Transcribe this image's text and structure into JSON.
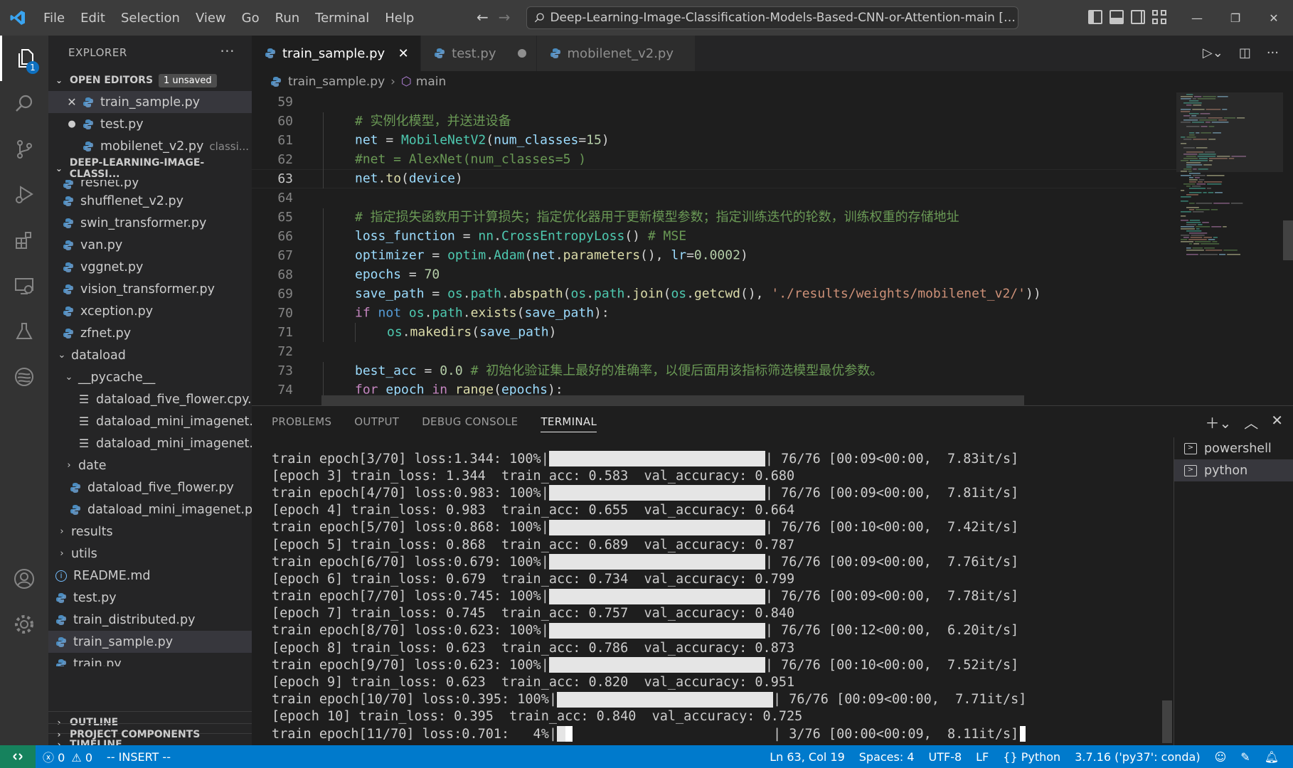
{
  "menu": [
    "File",
    "Edit",
    "Selection",
    "View",
    "Go",
    "Run",
    "Terminal",
    "Help"
  ],
  "search": {
    "text": "Deep-Learning-Image-Classification-Models-Based-CNN-or-Attention-main [Administ..."
  },
  "activity": {
    "explorer_badge": "1"
  },
  "explorer": {
    "title": "EXPLORER",
    "open_editors": {
      "label": "OPEN EDITORS",
      "badge": "1 unsaved",
      "items": [
        {
          "name": "train_sample.py",
          "desc": ""
        },
        {
          "name": "test.py",
          "desc": ""
        },
        {
          "name": "mobilenet_v2.py",
          "desc": "classi..."
        }
      ]
    },
    "folder": {
      "label": "DEEP-LEARNING-IMAGE-CLASSI...",
      "partial": "resnet.py",
      "files": [
        "shufflenet_v2.py",
        "swin_transformer.py",
        "van.py",
        "vggnet.py",
        "vision_transformer.py",
        "xception.py",
        "zfnet.py"
      ],
      "dataload": "dataload",
      "pycache": "__pycache__",
      "pycache_files": [
        "dataload_five_flower.cpy...",
        "dataload_mini_imagenet...",
        "dataload_mini_imagenet..."
      ],
      "date": "date",
      "dataload_files": [
        "dataload_five_flower.py",
        "dataload_mini_imagenet.py"
      ],
      "results": "results",
      "utils": "utils",
      "readme": "README.md",
      "root_files": [
        "test.py",
        "train_distributed.py",
        "train_sample.py",
        "train.py"
      ]
    },
    "outline": "OUTLINE",
    "timeline": "TIMELINE",
    "project_components": "PROJECT COMPONENTS"
  },
  "tabs": [
    {
      "label": "train_sample.py",
      "state": "active"
    },
    {
      "label": "test.py",
      "state": "unsaved"
    },
    {
      "label": "mobilenet_v2.py",
      "state": "normal"
    }
  ],
  "breadcrumb": {
    "file": "train_sample.py",
    "symbol": "main"
  },
  "code": {
    "current_line": 63,
    "lines": [
      {
        "n": "59",
        "indent": 0,
        "t": []
      },
      {
        "n": "60",
        "indent": 1,
        "t": [
          {
            "c": "cm",
            "s": "# 实例化模型，并送进设备"
          }
        ]
      },
      {
        "n": "61",
        "indent": 1,
        "t": [
          {
            "c": "vr",
            "s": "net"
          },
          {
            "c": "op",
            "s": " = "
          },
          {
            "c": "cl",
            "s": "MobileNetV2"
          },
          {
            "c": "op",
            "s": "("
          },
          {
            "c": "vr",
            "s": "num_classes"
          },
          {
            "c": "op",
            "s": "="
          },
          {
            "c": "nm",
            "s": "15"
          },
          {
            "c": "op",
            "s": ")"
          }
        ]
      },
      {
        "n": "62",
        "indent": 1,
        "t": [
          {
            "c": "cm",
            "s": "#net = AlexNet(num_classes=5 )"
          }
        ]
      },
      {
        "n": "63",
        "indent": 1,
        "t": [
          {
            "c": "vr",
            "s": "net"
          },
          {
            "c": "op",
            "s": "."
          },
          {
            "c": "fn",
            "s": "to"
          },
          {
            "c": "op",
            "s": "("
          },
          {
            "c": "vr",
            "s": "device"
          },
          {
            "c": "op",
            "s": ")"
          }
        ]
      },
      {
        "n": "64",
        "indent": 0,
        "t": []
      },
      {
        "n": "65",
        "indent": 1,
        "t": [
          {
            "c": "cm",
            "s": "# 指定损失函数用于计算损失；指定优化器用于更新模型参数；指定训练迭代的轮数，训练权重的存储地址"
          }
        ]
      },
      {
        "n": "66",
        "indent": 1,
        "t": [
          {
            "c": "vr",
            "s": "loss_function"
          },
          {
            "c": "op",
            "s": " = "
          },
          {
            "c": "cl",
            "s": "nn"
          },
          {
            "c": "op",
            "s": "."
          },
          {
            "c": "cl",
            "s": "CrossEntropyLoss"
          },
          {
            "c": "op",
            "s": "() "
          },
          {
            "c": "cm",
            "s": "# MSE"
          }
        ]
      },
      {
        "n": "67",
        "indent": 1,
        "t": [
          {
            "c": "vr",
            "s": "optimizer"
          },
          {
            "c": "op",
            "s": " = "
          },
          {
            "c": "cl",
            "s": "optim"
          },
          {
            "c": "op",
            "s": "."
          },
          {
            "c": "cl",
            "s": "Adam"
          },
          {
            "c": "op",
            "s": "("
          },
          {
            "c": "vr",
            "s": "net"
          },
          {
            "c": "op",
            "s": "."
          },
          {
            "c": "fn",
            "s": "parameters"
          },
          {
            "c": "op",
            "s": "(), "
          },
          {
            "c": "vr",
            "s": "lr"
          },
          {
            "c": "op",
            "s": "="
          },
          {
            "c": "nm",
            "s": "0.0002"
          },
          {
            "c": "op",
            "s": ")"
          }
        ]
      },
      {
        "n": "68",
        "indent": 1,
        "t": [
          {
            "c": "vr",
            "s": "epochs"
          },
          {
            "c": "op",
            "s": " = "
          },
          {
            "c": "nm",
            "s": "70"
          }
        ]
      },
      {
        "n": "69",
        "indent": 1,
        "t": [
          {
            "c": "vr",
            "s": "save_path"
          },
          {
            "c": "op",
            "s": " = "
          },
          {
            "c": "cl",
            "s": "os"
          },
          {
            "c": "op",
            "s": "."
          },
          {
            "c": "cl",
            "s": "path"
          },
          {
            "c": "op",
            "s": "."
          },
          {
            "c": "fn",
            "s": "abspath"
          },
          {
            "c": "op",
            "s": "("
          },
          {
            "c": "cl",
            "s": "os"
          },
          {
            "c": "op",
            "s": "."
          },
          {
            "c": "cl",
            "s": "path"
          },
          {
            "c": "op",
            "s": "."
          },
          {
            "c": "fn",
            "s": "join"
          },
          {
            "c": "op",
            "s": "("
          },
          {
            "c": "cl",
            "s": "os"
          },
          {
            "c": "op",
            "s": "."
          },
          {
            "c": "fn",
            "s": "getcwd"
          },
          {
            "c": "op",
            "s": "(), "
          },
          {
            "c": "st",
            "s": "'./results/weights/mobilenet_v2/'"
          },
          {
            "c": "op",
            "s": "))"
          }
        ]
      },
      {
        "n": "70",
        "indent": 1,
        "t": [
          {
            "c": "kw",
            "s": "if"
          },
          {
            "c": "op",
            "s": " "
          },
          {
            "c": "kb",
            "s": "not"
          },
          {
            "c": "op",
            "s": " "
          },
          {
            "c": "cl",
            "s": "os"
          },
          {
            "c": "op",
            "s": "."
          },
          {
            "c": "cl",
            "s": "path"
          },
          {
            "c": "op",
            "s": "."
          },
          {
            "c": "fn",
            "s": "exists"
          },
          {
            "c": "op",
            "s": "("
          },
          {
            "c": "vr",
            "s": "save_path"
          },
          {
            "c": "op",
            "s": "):"
          }
        ]
      },
      {
        "n": "71",
        "indent": 2,
        "t": [
          {
            "c": "cl",
            "s": "os"
          },
          {
            "c": "op",
            "s": "."
          },
          {
            "c": "fn",
            "s": "makedirs"
          },
          {
            "c": "op",
            "s": "("
          },
          {
            "c": "vr",
            "s": "save_path"
          },
          {
            "c": "op",
            "s": ")"
          }
        ]
      },
      {
        "n": "72",
        "indent": 0,
        "t": []
      },
      {
        "n": "73",
        "indent": 1,
        "t": [
          {
            "c": "vr",
            "s": "best_acc"
          },
          {
            "c": "op",
            "s": " = "
          },
          {
            "c": "nm",
            "s": "0.0"
          },
          {
            "c": "op",
            "s": " "
          },
          {
            "c": "cm",
            "s": "# 初始化验证集上最好的准确率，以便后面用该指标筛选模型最优参数。"
          }
        ]
      },
      {
        "n": "74",
        "indent": 1,
        "t": [
          {
            "c": "kw",
            "s": "for"
          },
          {
            "c": "op",
            "s": " "
          },
          {
            "c": "vr",
            "s": "epoch"
          },
          {
            "c": "op",
            "s": " "
          },
          {
            "c": "kw",
            "s": "in"
          },
          {
            "c": "op",
            "s": " "
          },
          {
            "c": "fn",
            "s": "range"
          },
          {
            "c": "op",
            "s": "("
          },
          {
            "c": "vr",
            "s": "epochs"
          },
          {
            "c": "op",
            "s": "):"
          }
        ]
      }
    ]
  },
  "panel": {
    "tabs": [
      "PROBLEMS",
      "OUTPUT",
      "DEBUG CONSOLE",
      "TERMINAL"
    ],
    "active_tab": "TERMINAL",
    "terminals": [
      "powershell",
      "python"
    ],
    "lines": [
      {
        "type": "progress",
        "prefix": "train epoch[3/70] loss:1.344: 100%|",
        "progress": 1.0,
        "suffix": "| 76/76 [00:09<00:00,  7.83it/s]"
      },
      {
        "type": "text",
        "text": "[epoch 3] train_loss: 1.344  train_acc: 0.583  val_accuracy: 0.680"
      },
      {
        "type": "progress",
        "prefix": "train epoch[4/70] loss:0.983: 100%|",
        "progress": 1.0,
        "suffix": "| 76/76 [00:09<00:00,  7.81it/s]"
      },
      {
        "type": "text",
        "text": "[epoch 4] train_loss: 0.983  train_acc: 0.655  val_accuracy: 0.664"
      },
      {
        "type": "progress",
        "prefix": "train epoch[5/70] loss:0.868: 100%|",
        "progress": 1.0,
        "suffix": "| 76/76 [00:10<00:00,  7.42it/s]"
      },
      {
        "type": "text",
        "text": "[epoch 5] train_loss: 0.868  train_acc: 0.689  val_accuracy: 0.787"
      },
      {
        "type": "progress",
        "prefix": "train epoch[6/70] loss:0.679: 100%|",
        "progress": 1.0,
        "suffix": "| 76/76 [00:09<00:00,  7.76it/s]"
      },
      {
        "type": "text",
        "text": "[epoch 6] train_loss: 0.679  train_acc: 0.734  val_accuracy: 0.799"
      },
      {
        "type": "progress",
        "prefix": "train epoch[7/70] loss:0.745: 100%|",
        "progress": 1.0,
        "suffix": "| 76/76 [00:09<00:00,  7.78it/s]"
      },
      {
        "type": "text",
        "text": "[epoch 7] train_loss: 0.745  train_acc: 0.757  val_accuracy: 0.840"
      },
      {
        "type": "progress",
        "prefix": "train epoch[8/70] loss:0.623: 100%|",
        "progress": 1.0,
        "suffix": "| 76/76 [00:12<00:00,  6.20it/s]"
      },
      {
        "type": "text",
        "text": "[epoch 8] train_loss: 0.623  train_acc: 0.786  val_accuracy: 0.873"
      },
      {
        "type": "progress",
        "prefix": "train epoch[9/70] loss:0.623: 100%|",
        "progress": 1.0,
        "suffix": "| 76/76 [00:10<00:00,  7.52it/s]"
      },
      {
        "type": "text",
        "text": "[epoch 9] train_loss: 0.623  train_acc: 0.820  val_accuracy: 0.951"
      },
      {
        "type": "progress",
        "prefix": "train epoch[10/70] loss:0.395: 100%|",
        "progress": 1.0,
        "suffix": "| 76/76 [00:09<00:00,  7.71it/s]"
      },
      {
        "type": "text",
        "text": "[epoch 10] train_loss: 0.395  train_acc: 0.840  val_accuracy: 0.725"
      },
      {
        "type": "progress",
        "prefix": "train epoch[11/70] loss:0.701:   4%|",
        "progress": 0.04,
        "suffix": "| 3/76 [00:00<00:09,  8.11it/s]",
        "cursor": true
      }
    ]
  },
  "status": {
    "errors": "0",
    "warnings": "0",
    "mode": "-- INSERT --",
    "position": "Ln 63, Col 19",
    "spaces": "Spaces: 4",
    "encoding": "UTF-8",
    "eol": "LF",
    "language": "Python",
    "interpreter": "3.7.16 ('py37': conda)"
  },
  "colors": {
    "accent": "#007acc",
    "remote": "#16825d",
    "comment": "#6a9955",
    "keyword": "#c586c0",
    "keyword_blue": "#569cd6",
    "string": "#ce9178",
    "number": "#b5cea8",
    "function": "#dcdcaa",
    "class": "#4ec9b0",
    "variable": "#9cdcfe"
  },
  "icons": [
    "vscode-logo-icon",
    "files-icon",
    "search-icon",
    "source-control-icon",
    "run-debug-icon",
    "extensions-icon",
    "remote-explorer-icon",
    "testing-icon",
    "python-icon",
    "account-icon",
    "gear-icon"
  ]
}
